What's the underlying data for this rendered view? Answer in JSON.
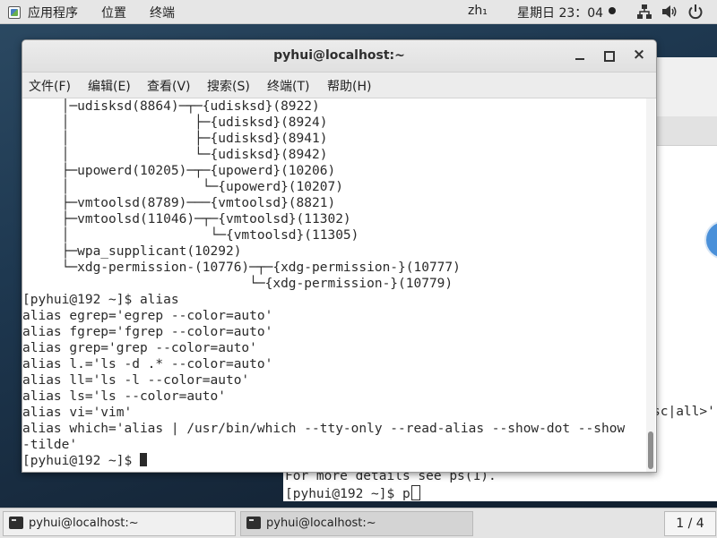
{
  "top_bar": {
    "apps_menu": "应用程序",
    "places_menu": "位置",
    "terminal_menu": "终端",
    "input_method": "zh₁",
    "clock": "星期日 23：04",
    "icons": [
      "network-icon",
      "volume-icon",
      "power-icon"
    ]
  },
  "window": {
    "title": "pyhui@localhost:~",
    "menu": [
      "文件(F)",
      "编辑(E)",
      "查看(V)",
      "搜索(S)",
      "终端(T)",
      "帮助(H)"
    ]
  },
  "terminal": {
    "lines": [
      "     │─udisksd(8864)─┬─{udisksd}(8922)",
      "     │                ├─{udisksd}(8924)",
      "     │                ├─{udisksd}(8941)",
      "     │                └─{udisksd}(8942)",
      "     ├─upowerd(10205)─┬─{upowerd}(10206)",
      "     │                 └─{upowerd}(10207)",
      "     ├─vmtoolsd(8789)───{vmtoolsd}(8821)",
      "     ├─vmtoolsd(11046)─┬─{vmtoolsd}(11302)",
      "     │                  └─{vmtoolsd}(11305)",
      "     ├─wpa_supplicant(10292)",
      "     └─xdg-permission-(10776)─┬─{xdg-permission-}(10777)",
      "                             └─{xdg-permission-}(10779)",
      "[pyhui@192 ~]$ alias",
      "alias egrep='egrep --color=auto'",
      "alias fgrep='fgrep --color=auto'",
      "alias grep='grep --color=auto'",
      "alias l.='ls -d .* --color=auto'",
      "alias ll='ls -l --color=auto'",
      "alias ls='ls --color=auto'",
      "alias vi='vim'",
      "alias which='alias | /usr/bin/which --tty-only --read-alias --show-dot --show",
      "-tilde'",
      "[pyhui@192 ~]$ "
    ]
  },
  "background_terminal": {
    "fragment_1": "sc|all>'",
    "fragment_2": "For more details see ps(1).",
    "prompt": "[pyhui@192 ~]$ p"
  },
  "taskbar": {
    "tasks": [
      {
        "label": "pyhui@localhost:~"
      },
      {
        "label": "pyhui@localhost:~"
      }
    ],
    "workspace": "1 / 4"
  }
}
